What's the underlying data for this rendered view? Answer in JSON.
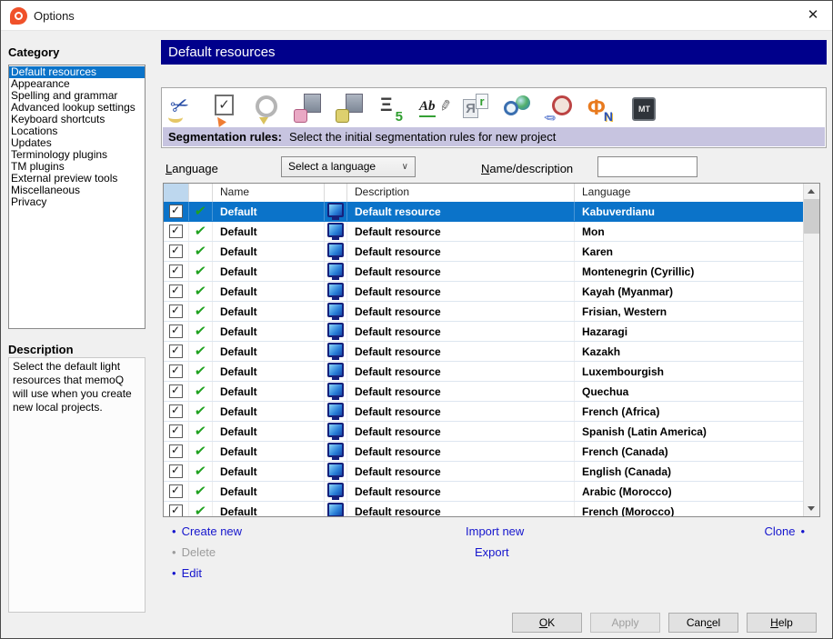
{
  "window": {
    "title": "Options",
    "close_glyph": "✕"
  },
  "sidebar": {
    "category_label": "Category",
    "items": [
      {
        "label": "Default resources",
        "selected": true
      },
      {
        "label": "Appearance"
      },
      {
        "label": "Spelling and grammar"
      },
      {
        "label": "Advanced lookup settings"
      },
      {
        "label": "Keyboard shortcuts"
      },
      {
        "label": "Locations"
      },
      {
        "label": "Updates"
      },
      {
        "label": "Terminology plugins"
      },
      {
        "label": "TM plugins"
      },
      {
        "label": "External preview tools"
      },
      {
        "label": "Miscellaneous"
      },
      {
        "label": "Privacy"
      }
    ],
    "description_label": "Description",
    "description_text": "Select the default light resources that memoQ will use when you create new local projects."
  },
  "main": {
    "page_title": "Default resources",
    "toolbar": {
      "icons": [
        {
          "name": "segmentation-rules-icon"
        },
        {
          "name": "qa-settings-icon"
        },
        {
          "name": "auto-translation-rules-icon"
        },
        {
          "name": "filter-configurations-icon"
        },
        {
          "name": "export-path-rules-icon"
        },
        {
          "name": "non-translatable-lists-icon"
        },
        {
          "name": "ignore-lists-icon"
        },
        {
          "name": "autocorrect-sets-icon"
        },
        {
          "name": "web-search-settings-icon"
        },
        {
          "name": "lqa-models-icon"
        },
        {
          "name": "font-substitution-icon"
        },
        {
          "name": "mt-settings-icon"
        }
      ],
      "caption_label": "Segmentation rules:",
      "caption_text": "Select the initial segmentation rules for new project"
    },
    "filters": {
      "language_label": {
        "text": "Language",
        "accel": 0
      },
      "language_value": "Select a language",
      "dropdown_chevron": "∨",
      "name_label": {
        "text": "Name/description",
        "accel": 0
      },
      "name_value": ""
    },
    "table": {
      "columns": [
        "",
        "",
        "Name",
        "",
        "Description",
        "Language"
      ],
      "rows": [
        {
          "checked": true,
          "name": "Default",
          "description": "Default resource",
          "language": "Kabuverdianu",
          "selected": true
        },
        {
          "checked": true,
          "name": "Default",
          "description": "Default resource",
          "language": "Mon"
        },
        {
          "checked": true,
          "name": "Default",
          "description": "Default resource",
          "language": "Karen"
        },
        {
          "checked": true,
          "name": "Default",
          "description": "Default resource",
          "language": "Montenegrin (Cyrillic)"
        },
        {
          "checked": true,
          "name": "Default",
          "description": "Default resource",
          "language": "Kayah (Myanmar)"
        },
        {
          "checked": true,
          "name": "Default",
          "description": "Default resource",
          "language": "Frisian, Western"
        },
        {
          "checked": true,
          "name": "Default",
          "description": "Default resource",
          "language": "Hazaragi"
        },
        {
          "checked": true,
          "name": "Default",
          "description": "Default resource",
          "language": "Kazakh"
        },
        {
          "checked": true,
          "name": "Default",
          "description": "Default resource",
          "language": "Luxembourgish"
        },
        {
          "checked": true,
          "name": "Default",
          "description": "Default resource",
          "language": "Quechua"
        },
        {
          "checked": true,
          "name": "Default",
          "description": "Default resource",
          "language": "French (Africa)"
        },
        {
          "checked": true,
          "name": "Default",
          "description": "Default resource",
          "language": "Spanish (Latin America)"
        },
        {
          "checked": true,
          "name": "Default",
          "description": "Default resource",
          "language": "French (Canada)"
        },
        {
          "checked": true,
          "name": "Default",
          "description": "Default resource",
          "language": "English (Canada)"
        },
        {
          "checked": true,
          "name": "Default",
          "description": "Default resource",
          "language": "Arabic (Morocco)"
        },
        {
          "checked": true,
          "name": "Default",
          "description": "Default resource",
          "language": "French (Morocco)"
        }
      ]
    },
    "links": {
      "create_new": {
        "text": "Create new"
      },
      "delete": {
        "text": "Delete",
        "disabled": true
      },
      "edit": {
        "text": "Edit"
      },
      "import_new": {
        "text": "Import new"
      },
      "export": {
        "text": "Export"
      },
      "clone": {
        "text": "Clone"
      }
    }
  },
  "footer": {
    "ok": {
      "text": "OK",
      "accel": 0
    },
    "apply": {
      "text": "Apply",
      "disabled": true
    },
    "cancel": {
      "text": "Cancel",
      "accel": 3
    },
    "help": {
      "text": "Help",
      "accel": 0
    }
  },
  "colors": {
    "selection_blue": "#0b73c9",
    "header_navy": "#00008b",
    "caption_lavender": "#c7c4e0",
    "link_blue": "#1515cd",
    "header_cell_blue": "#bdd7ee",
    "dialog_background": "#f0f0f0",
    "brand_orange": "#f0512a"
  }
}
